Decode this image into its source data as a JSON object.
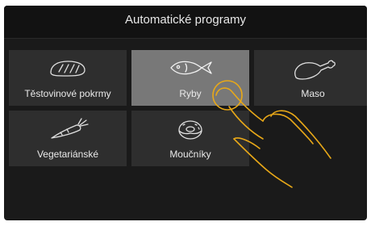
{
  "header": {
    "title": "Automatické programy"
  },
  "programs": [
    {
      "label": "Těstovinové pokrmy",
      "icon": "bread-icon",
      "selected": false
    },
    {
      "label": "Ryby",
      "icon": "fish-icon",
      "selected": true
    },
    {
      "label": "Maso",
      "icon": "meat-drumstick-icon",
      "selected": false
    },
    {
      "label": "Vegetariánské",
      "icon": "carrot-icon",
      "selected": false
    },
    {
      "label": "Moučníky",
      "icon": "donut-icon",
      "selected": false
    }
  ],
  "colors": {
    "background": "#1a1a1a",
    "tile": "#2e2e2e",
    "tile_selected": "#787878",
    "accent_touch": "#e8a818"
  },
  "touch_hint": {
    "icon": "tapping-hand-icon"
  }
}
